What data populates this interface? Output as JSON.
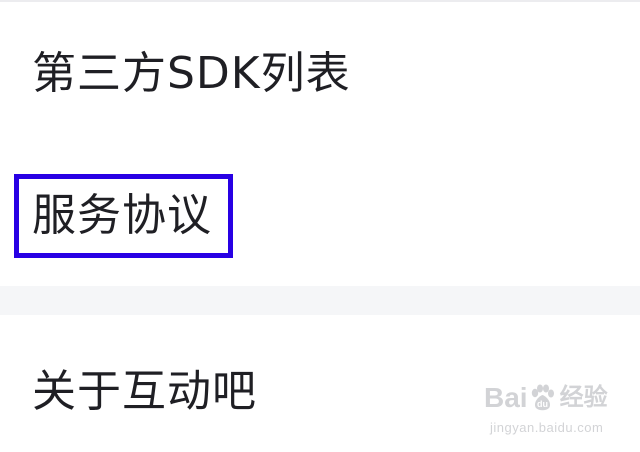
{
  "settings": {
    "items": [
      {
        "label": "第三方SDK列表"
      },
      {
        "label": "服务协议"
      },
      {
        "label": "关于互动吧"
      }
    ]
  },
  "watermark": {
    "brand_prefix": "Bai",
    "brand_suffix": "经验",
    "url": "jingyan.baidu.com"
  },
  "colors": {
    "highlight": "#2800e4",
    "text": "#1f1f24",
    "divider": "#e6e6ea",
    "section_gap": "#f5f6f8"
  }
}
